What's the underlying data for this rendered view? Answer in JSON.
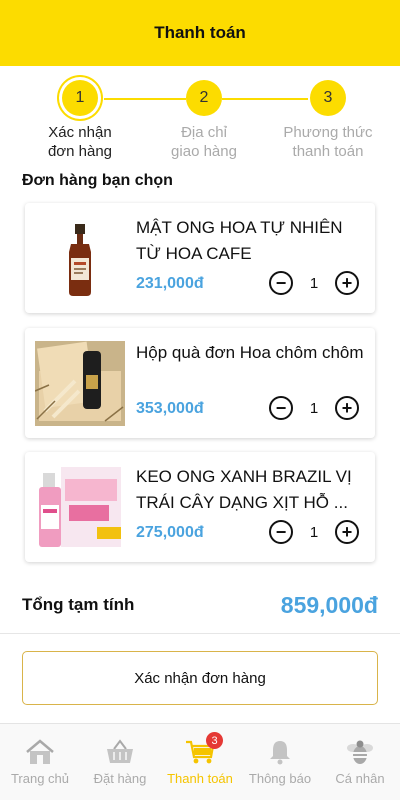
{
  "header": {
    "title": "Thanh toán"
  },
  "steps": [
    {
      "number": "1",
      "label_line1": "Xác nhận",
      "label_line2": "đơn hàng"
    },
    {
      "number": "2",
      "label_line1": "Địa chỉ",
      "label_line2": "giao hàng"
    },
    {
      "number": "3",
      "label_line1": "Phương thức",
      "label_line2": "thanh toán"
    }
  ],
  "section_title": "Đơn hàng bạn chọn",
  "items": [
    {
      "name": "MẬT ONG HOA TỰ NHIÊN TỪ HOA CAFE",
      "price": "231,000đ",
      "qty": "1"
    },
    {
      "name": "Hộp quà đơn  Hoa chôm chôm",
      "price": "353,000đ",
      "qty": "1"
    },
    {
      "name": "KEO ONG XANH BRAZIL VỊ TRÁI CÂY DẠNG XỊT HỖ ...",
      "price": "275,000đ",
      "qty": "1"
    }
  ],
  "qty_controls": {
    "minus": "−",
    "plus": "+"
  },
  "total": {
    "label": "Tổng tạm tính",
    "value": "859,000đ"
  },
  "confirm_button": "Xác nhận đơn hàng",
  "tabbar": {
    "tabs": [
      {
        "label": "Trang chủ",
        "icon": "house-icon"
      },
      {
        "label": "Đặt hàng",
        "icon": "basket-icon"
      },
      {
        "label": "Thanh toán",
        "icon": "cart-icon",
        "badge": "3"
      },
      {
        "label": "Thông báo",
        "icon": "bell-icon"
      },
      {
        "label": "Cá nhân",
        "icon": "bee-icon"
      }
    ]
  },
  "colors": {
    "brand_yellow": "#fcdc00",
    "price_blue": "#4aa3df",
    "badge_red": "#e53935"
  }
}
